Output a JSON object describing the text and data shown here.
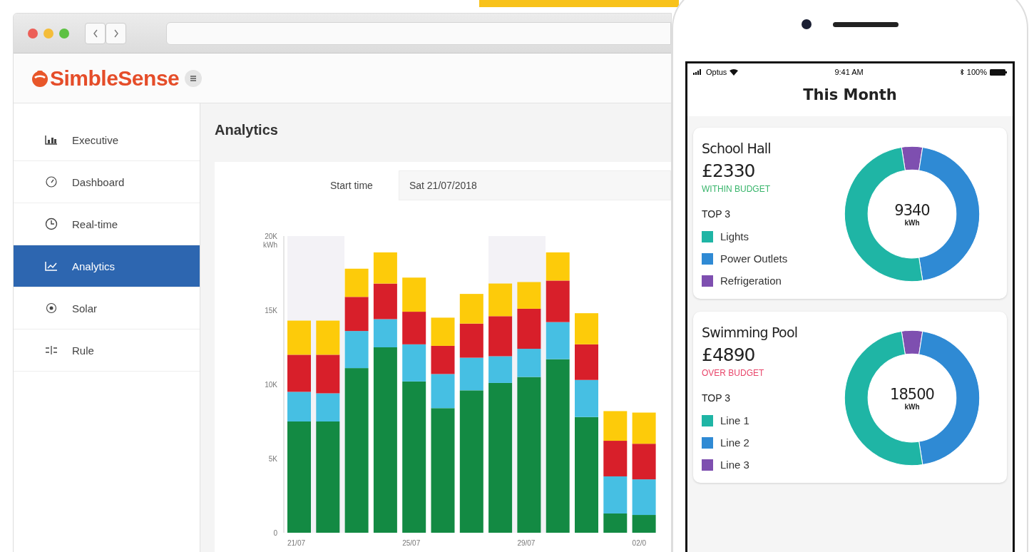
{
  "browser": {
    "logo": "SimbleSense",
    "sidebar": {
      "items": [
        {
          "label": "Executive",
          "selected": false
        },
        {
          "label": "Dashboard",
          "selected": false
        },
        {
          "label": "Real-time",
          "selected": false
        },
        {
          "label": "Analytics",
          "selected": true
        },
        {
          "label": "Solar",
          "selected": false
        },
        {
          "label": "Rule",
          "selected": false
        }
      ]
    },
    "page_title": "Analytics",
    "start_time": {
      "label": "Start time",
      "value": "Sat 21/07/2018"
    },
    "chart_data": {
      "type": "bar",
      "stacked": true,
      "ylabel": "kWh",
      "categories": [
        "21/07",
        null,
        null,
        null,
        "25/07",
        null,
        null,
        null,
        "29/07",
        null,
        null,
        null,
        "02/0"
      ],
      "ylim": [
        0,
        20000
      ],
      "yticks": [
        {
          "value": 0,
          "label": "0"
        },
        {
          "value": 5000,
          "label": "5K"
        },
        {
          "value": 10000,
          "label": "10K"
        },
        {
          "value": 15000,
          "label": "15K"
        },
        {
          "value": 20000,
          "label": "20K"
        }
      ],
      "series": [
        {
          "color": "#138a43",
          "values": [
            7500,
            7500,
            11100,
            12500,
            10200,
            8400,
            9600,
            10100,
            10500,
            11700,
            7800,
            1300,
            1200
          ]
        },
        {
          "color": "#46bfe3",
          "values": [
            2000,
            1900,
            2500,
            1900,
            2500,
            2300,
            2200,
            1800,
            1900,
            2500,
            2500,
            2500,
            2400
          ]
        },
        {
          "color": "#d81f2a",
          "values": [
            2500,
            2600,
            2300,
            2400,
            2200,
            1900,
            2300,
            2700,
            2700,
            2800,
            2400,
            2400,
            2400
          ]
        },
        {
          "color": "#fdcb0a",
          "values": [
            2300,
            2300,
            1900,
            2100,
            2300,
            1900,
            2000,
            2200,
            1800,
            1900,
            2100,
            2000,
            2100
          ]
        }
      ]
    }
  },
  "phone": {
    "status_bar": {
      "carrier": "Optus",
      "time": "9:41 AM",
      "battery": "100%"
    },
    "title": "This Month",
    "cards": [
      {
        "name": "School Hall",
        "cost": "£2330",
        "budget": "WITHIN BUDGET",
        "over_budget": false,
        "top_label": "TOP 3",
        "total": "9340",
        "unit": "kWh",
        "legend": [
          {
            "label": "Lights",
            "color": "#1fb5a5"
          },
          {
            "label": "Power Outlets",
            "color": "#2f8ad4"
          },
          {
            "label": "Refrigeration",
            "color": "#7e4fb0"
          }
        ]
      },
      {
        "name": "Swimming Pool",
        "cost": "£4890",
        "budget": "OVER BUDGET",
        "over_budget": true,
        "top_label": "TOP 3",
        "total": "18500",
        "unit": "kWh",
        "legend": [
          {
            "label": "Line 1",
            "color": "#1fb5a5"
          },
          {
            "label": "Line 2",
            "color": "#2f8ad4"
          },
          {
            "label": "Line 3",
            "color": "#7e4fb0"
          }
        ]
      }
    ]
  }
}
